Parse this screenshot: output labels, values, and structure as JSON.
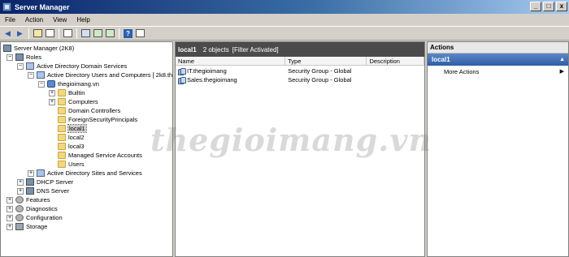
{
  "window": {
    "title": "Server Manager"
  },
  "window_controls": {
    "minimize": "_",
    "maximize": "□",
    "close": "x"
  },
  "menu": [
    "File",
    "Action",
    "View",
    "Help"
  ],
  "toolbar": {
    "icons": [
      "back-arrow-icon",
      "forward-arrow-icon",
      "up-folder-icon",
      "show-hide-tree-icon",
      "copy-icon",
      "properties-icon",
      "refresh-icon",
      "export-icon",
      "help-icon",
      "show-hide-action-icon"
    ],
    "help_label": "?"
  },
  "tree": {
    "nodes": [
      {
        "label": "Server Manager (2K8)",
        "expander": "",
        "icon": "server-manager"
      },
      {
        "label": "Roles",
        "expander": "−",
        "icon": "roles"
      },
      {
        "label": "Active Directory Domain Services",
        "expander": "−",
        "icon": "ad"
      },
      {
        "label": "Active Directory Users and Computers [ 2k8.th",
        "expander": "−",
        "icon": "ad"
      },
      {
        "label": "thegioimang.vn",
        "expander": "−",
        "icon": "domain"
      },
      {
        "label": "Builtin",
        "expander": "+",
        "icon": "folder"
      },
      {
        "label": "Computers",
        "expander": "+",
        "icon": "folder"
      },
      {
        "label": "Domain Controllers",
        "expander": "",
        "icon": "folder"
      },
      {
        "label": "ForeignSecurityPrincipals",
        "expander": "",
        "icon": "folder"
      },
      {
        "label": "local1",
        "expander": "",
        "icon": "folder",
        "selected": true
      },
      {
        "label": "local2",
        "expander": "",
        "icon": "folder"
      },
      {
        "label": "local3",
        "expander": "",
        "icon": "folder"
      },
      {
        "label": "Managed Service Accounts",
        "expander": "",
        "icon": "folder"
      },
      {
        "label": "Users",
        "expander": "",
        "icon": "folder"
      },
      {
        "label": "Active Directory Sites and Services",
        "expander": "+",
        "icon": "ad"
      },
      {
        "label": "DHCP Server",
        "expander": "+",
        "icon": "server"
      },
      {
        "label": "DNS Server",
        "expander": "+",
        "icon": "server"
      },
      {
        "label": "Features",
        "expander": "+",
        "icon": "gear"
      },
      {
        "label": "Diagnostics",
        "expander": "+",
        "icon": "gear"
      },
      {
        "label": "Configuration",
        "expander": "+",
        "icon": "gear"
      },
      {
        "label": "Storage",
        "expander": "+",
        "icon": "storage"
      }
    ]
  },
  "center": {
    "title": "local1",
    "count": "2 objects",
    "filter": "[Filter Activated]",
    "columns": [
      "Name",
      "Type",
      "Description"
    ],
    "rows": [
      {
        "name": "IT.thegioimang",
        "type": "Security Group - Global",
        "description": ""
      },
      {
        "name": "Sales.thegioimang",
        "type": "Security Group - Global",
        "description": ""
      }
    ]
  },
  "actions": {
    "title": "Actions",
    "section": "local1",
    "section_toggle": "▲",
    "items": [
      {
        "label": "More Actions",
        "arrow": "▶"
      }
    ]
  },
  "watermark": "thegioimang.vn"
}
